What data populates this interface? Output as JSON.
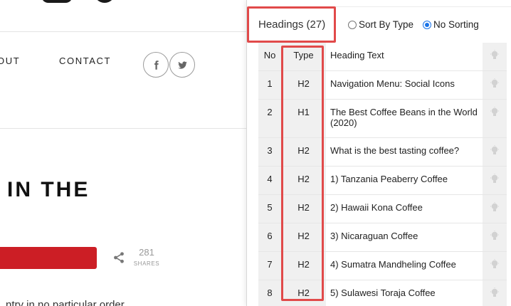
{
  "site": {
    "nav": [
      "OUT",
      "CONTACT"
    ],
    "social_icons": [
      "facebook-icon",
      "twitter-icon"
    ],
    "post_title": "IN THE",
    "share_count": "281",
    "share_label": "SHARES",
    "body_snippet": "ntry in no particular order"
  },
  "panel": {
    "tab_label": "Headings (27)",
    "sort_options": [
      {
        "label": "Sort By Type",
        "selected": false
      },
      {
        "label": "No Sorting",
        "selected": true
      }
    ],
    "columns": {
      "no": "No",
      "type": "Type",
      "text": "Heading Text"
    },
    "rows": [
      {
        "no": "1",
        "type": "H2",
        "text": "Navigation Menu: Social Icons"
      },
      {
        "no": "2",
        "type": "H1",
        "text": "The Best Coffee Beans in the World (2020)"
      },
      {
        "no": "3",
        "type": "H2",
        "text": "What is the best tasting coffee?"
      },
      {
        "no": "4",
        "type": "H2",
        "text": "1) Tanzania Peaberry Coffee"
      },
      {
        "no": "5",
        "type": "H2",
        "text": "2) Hawaii Kona Coffee"
      },
      {
        "no": "6",
        "type": "H2",
        "text": "3) Nicaraguan Coffee"
      },
      {
        "no": "7",
        "type": "H2",
        "text": "4) Sumatra Mandheling Coffee"
      },
      {
        "no": "8",
        "type": "H2",
        "text": "5) Sulawesi Toraja Coffee"
      }
    ],
    "row_action_icon": "lightbulb-icon",
    "highlight_color": "#e14a4a",
    "radio_accent": "#1a73e8"
  }
}
